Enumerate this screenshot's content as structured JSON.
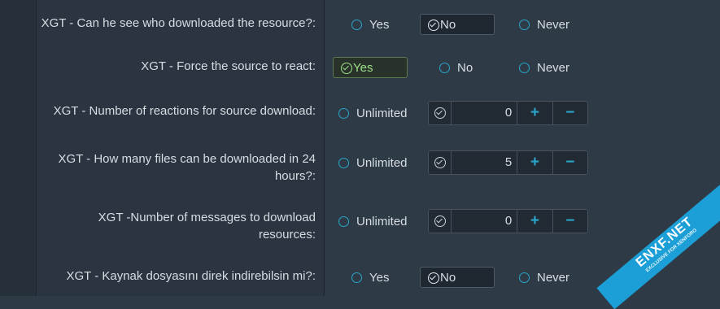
{
  "rows": [
    {
      "label": "XGT - Can he see who downloaded the resource?:",
      "options": [
        "Yes",
        "No",
        "Never"
      ],
      "selected": "No"
    },
    {
      "label": "XGT - Force the source to react:",
      "options": [
        "Yes",
        "No",
        "Never"
      ],
      "selected": "Yes"
    },
    {
      "label": "XGT - Number of reactions for source download:",
      "unlimited_label": "Unlimited",
      "value": "0"
    },
    {
      "label": "XGT - How many files can be downloaded in 24 hours?:",
      "unlimited_label": "Unlimited",
      "value": "5"
    },
    {
      "label": "XGT -Number of messages to download resources:",
      "unlimited_label": "Unlimited",
      "value": "0"
    },
    {
      "label": "XGT - Kaynak dosyasını direk indirebilsin mi?:",
      "options": [
        "Yes",
        "No",
        "Never"
      ],
      "selected": "No"
    }
  ],
  "stepper": {
    "plus": "+",
    "minus": "−"
  },
  "watermark": {
    "line1": "ENXF.NET",
    "line2": "EXCLUSIVE FOR XENFORO"
  },
  "colors": {
    "accent": "#2aa5c9",
    "success": "#9fe08a",
    "background": "#2e3a46"
  }
}
